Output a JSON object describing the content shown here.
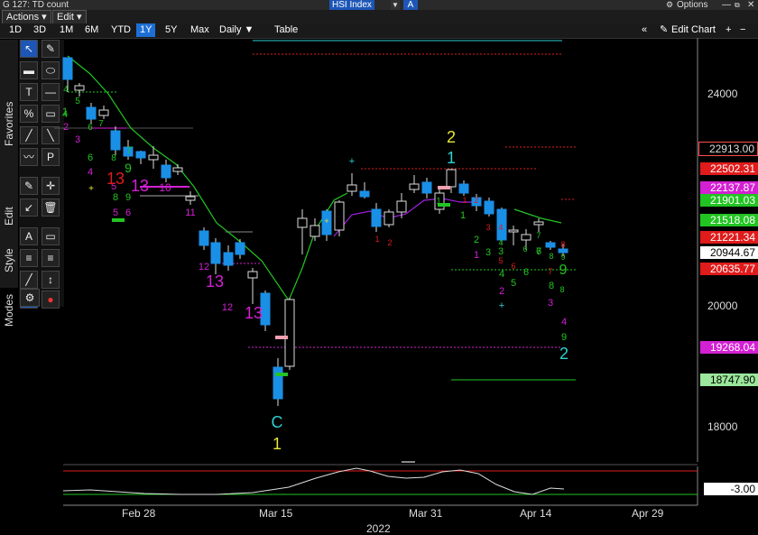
{
  "window": {
    "title": "G 127: TD count",
    "security": "HSI Index",
    "security_suffix": "A",
    "options": "Options",
    "options_icon": "gear-icon"
  },
  "menu": {
    "actions": "Actions",
    "edit": "Edit"
  },
  "timeframes": [
    "1D",
    "3D",
    "1M",
    "6M",
    "YTD",
    "1Y",
    "5Y",
    "Max"
  ],
  "selected_timeframe": "1Y",
  "period": "Daily",
  "table_label": "Table",
  "edit_chart": "Edit Chart",
  "side_tabs": [
    "Favorites",
    "Edit",
    "Style",
    "Modes"
  ],
  "tool_glyphs": [
    "↖",
    "✎",
    "▬",
    "⬭",
    "T",
    "%",
    "—",
    "▭",
    "╱",
    "╲",
    "P",
    "≡",
    "✎",
    "✛",
    "↙",
    "🗑",
    "A",
    "▭",
    "≡",
    "↕",
    "╱",
    "↕",
    "C",
    "●",
    "⚙"
  ],
  "y_axis": {
    "ticks": [
      "24000",
      "20000",
      "18000"
    ]
  },
  "x_axis": {
    "ticks": [
      "Feb 28",
      "Mar 15",
      "Mar 31",
      "Apr 14",
      "Apr 29"
    ],
    "year": "2022"
  },
  "price_tags": [
    {
      "label": "22913.00",
      "bg": "#000000",
      "fg": "#ff4d4d",
      "border": "#ff4d4d"
    },
    {
      "label": "22502.31",
      "bg": "#e01b1b",
      "fg": "#ffffff",
      "border": "#e01b1b"
    },
    {
      "label": "22137.87",
      "bg": "#d320d3",
      "fg": "#ffffff",
      "border": "#d320d3"
    },
    {
      "label": "21901.03",
      "bg": "#22c422",
      "fg": "#ffffff",
      "border": "#22c422"
    },
    {
      "label": "21518.08",
      "bg": "#22c422",
      "fg": "#ffffff",
      "border": "#22c422"
    },
    {
      "label": "21221.34",
      "bg": "#e01b1b",
      "fg": "#ffffff",
      "border": "#e01b1b"
    },
    {
      "label": "20944.67",
      "bg": "#ffffff",
      "fg": "#000000",
      "border": "#ffffff"
    },
    {
      "label": "20635.77",
      "bg": "#e01b1b",
      "fg": "#ffffff",
      "border": "#e01b1b"
    },
    {
      "label": "19268.04",
      "bg": "#d320d3",
      "fg": "#ffffff",
      "border": "#d320d3"
    },
    {
      "label": "18747.90",
      "bg": "#9be79b",
      "fg": "#000000",
      "border": "#9be79b"
    }
  ],
  "oscillator": {
    "value_label": "-3.00"
  },
  "td_labels": [
    {
      "t": "4",
      "c": "#22c422"
    },
    {
      "t": "5",
      "c": "#22c422"
    },
    {
      "t": "1",
      "c": "#22c422"
    },
    {
      "t": "4",
      "c": "#22c422"
    },
    {
      "t": "2",
      "c": "#d320d3"
    },
    {
      "t": "6",
      "c": "#22c422"
    },
    {
      "t": "3",
      "c": "#d320d3"
    },
    {
      "t": "7",
      "c": "#22c422"
    },
    {
      "t": "6",
      "c": "#22c422"
    },
    {
      "t": "4",
      "c": "#d320d3"
    },
    {
      "t": "8",
      "c": "#22c422"
    },
    {
      "t": "5",
      "c": "#d320d3"
    },
    {
      "t": "7",
      "c": "#22c422"
    },
    {
      "t": "9",
      "c": "#22c422"
    },
    {
      "t": "13",
      "c": "#e01b1b"
    },
    {
      "t": "13",
      "c": "#d320d3"
    },
    {
      "t": "8",
      "c": "#22c422"
    },
    {
      "t": "9",
      "c": "#22c422"
    },
    {
      "t": "5",
      "c": "#d320d3"
    },
    {
      "t": "6",
      "c": "#d320d3"
    },
    {
      "t": "10",
      "c": "#d320d3"
    },
    {
      "t": "11",
      "c": "#d320d3"
    },
    {
      "t": "12",
      "c": "#d320d3"
    },
    {
      "t": "13",
      "c": "#d320d3"
    },
    {
      "t": "12",
      "c": "#d320d3"
    },
    {
      "t": "13",
      "c": "#d320d3"
    },
    {
      "t": "C",
      "c": "#2fd0d0"
    },
    {
      "t": "1",
      "c": "#e6e63a"
    },
    {
      "t": "2",
      "c": "#e6e63a"
    },
    {
      "t": "1",
      "c": "#2fd0d0"
    },
    {
      "t": "1",
      "c": "#e01b1b"
    },
    {
      "t": "2",
      "c": "#e01b1b"
    },
    {
      "t": "1",
      "c": "#22c422"
    },
    {
      "t": "1",
      "c": "#22c422"
    },
    {
      "t": "2",
      "c": "#22c422"
    },
    {
      "t": "3",
      "c": "#22c422"
    },
    {
      "t": "1",
      "c": "#d320d3"
    },
    {
      "t": "3",
      "c": "#22c422"
    },
    {
      "t": "4",
      "c": "#22c422"
    },
    {
      "t": "5",
      "c": "#22c422"
    },
    {
      "t": "2",
      "c": "#d320d3"
    },
    {
      "t": "5",
      "c": "#e01b1b"
    },
    {
      "t": "6",
      "c": "#e01b1b"
    },
    {
      "t": "7",
      "c": "#22c422"
    },
    {
      "t": "6",
      "c": "#22c422"
    },
    {
      "t": "7",
      "c": "#22c422"
    },
    {
      "t": "8",
      "c": "#22c422"
    },
    {
      "t": "9",
      "c": "#22c422"
    },
    {
      "t": "8",
      "c": "#22c422"
    },
    {
      "t": "3",
      "c": "#d320d3"
    },
    {
      "t": "4",
      "c": "#d320d3"
    },
    {
      "t": "9",
      "c": "#22c422"
    },
    {
      "t": "2",
      "c": "#2fd0d0"
    },
    {
      "t": "7",
      "c": "#e01b1b"
    },
    {
      "t": "8",
      "c": "#e01b1b"
    },
    {
      "t": "4",
      "c": "#22c422"
    },
    {
      "t": "3",
      "c": "#e01b1b"
    },
    {
      "t": "4",
      "c": "#e01b1b"
    },
    {
      "t": "1",
      "c": "#e01b1b"
    },
    {
      "t": "2",
      "c": "#e01b1b"
    },
    {
      "t": "6",
      "c": "#22c422"
    },
    {
      "t": "6",
      "c": "#22c422"
    },
    {
      "t": "8",
      "c": "#22c422"
    },
    {
      "t": "9",
      "c": "#22c422"
    },
    {
      "t": "+",
      "c": "#e6e63a"
    },
    {
      "t": "+",
      "c": "#2fd0d0"
    },
    {
      "t": "+",
      "c": "#2fd0d0"
    },
    {
      "t": "+",
      "c": "#e6e63a"
    }
  ]
}
